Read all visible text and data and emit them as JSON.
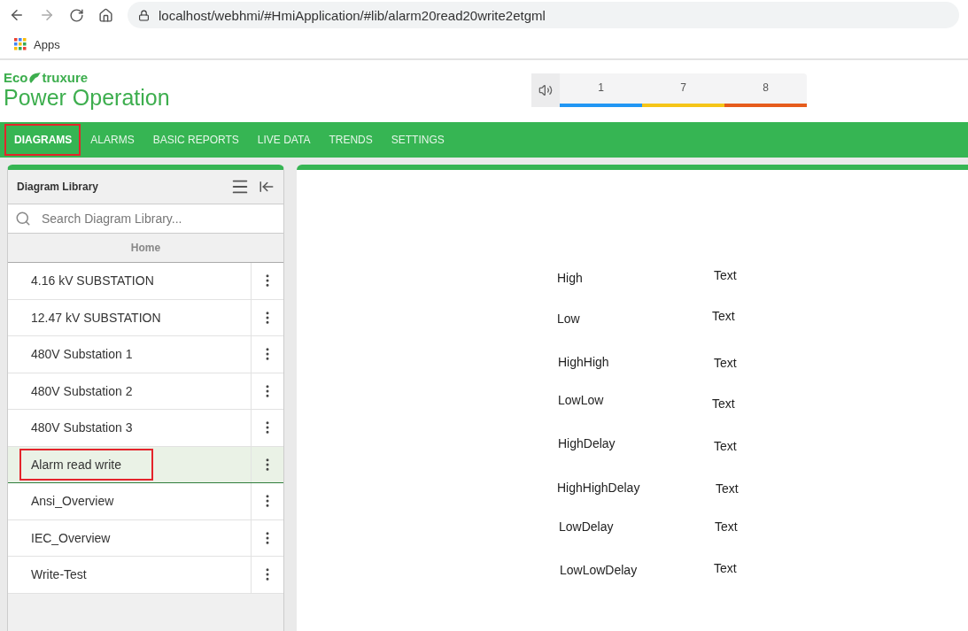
{
  "browser": {
    "url": "localhost/webhmi/#HmiApplication/#lib/alarm20read20write2etgml",
    "bookmarks": [
      "Apps"
    ]
  },
  "header": {
    "brand": "Eco",
    "brand_suffix": "truxure",
    "product": "Power Operation",
    "alarm_counts": [
      {
        "count": "1",
        "color": "#2196f3"
      },
      {
        "count": "7",
        "color": "#f5c518"
      },
      {
        "count": "8",
        "color": "#e65c1c"
      }
    ]
  },
  "nav": [
    {
      "label": "DIAGRAMS",
      "selected": true,
      "highlighted": true
    },
    {
      "label": "ALARMS",
      "selected": false,
      "highlighted": false
    },
    {
      "label": "BASIC REPORTS",
      "selected": false,
      "highlighted": false
    },
    {
      "label": "LIVE DATA",
      "selected": false,
      "highlighted": false
    },
    {
      "label": "TRENDS",
      "selected": false,
      "highlighted": false
    },
    {
      "label": "SETTINGS",
      "selected": false,
      "highlighted": false
    }
  ],
  "library": {
    "title": "Diagram Library",
    "search": {
      "placeholder": "Search Diagram Library..."
    },
    "breadcrumb": "Home",
    "items": [
      {
        "label": "4.16 kV SUBSTATION",
        "selected": false,
        "highlighted": false
      },
      {
        "label": "12.47 kV SUBSTATION",
        "selected": false,
        "highlighted": false
      },
      {
        "label": "480V Substation 1",
        "selected": false,
        "highlighted": false
      },
      {
        "label": "480V Substation 2",
        "selected": false,
        "highlighted": false
      },
      {
        "label": "480V Substation 3",
        "selected": false,
        "highlighted": false
      },
      {
        "label": "Alarm read write",
        "selected": true,
        "highlighted": true
      },
      {
        "label": "Ansi_Overview",
        "selected": false,
        "highlighted": false
      },
      {
        "label": "IEC_Overview",
        "selected": false,
        "highlighted": false
      },
      {
        "label": "Write-Test",
        "selected": false,
        "highlighted": false
      }
    ]
  },
  "diagram": {
    "rows": [
      {
        "label": "High",
        "value": "Text"
      },
      {
        "label": "Low",
        "value": "Text"
      },
      {
        "label": "HighHigh",
        "value": "Text"
      },
      {
        "label": "LowLow",
        "value": "Text"
      },
      {
        "label": "HighDelay",
        "value": "Text"
      },
      {
        "label": "HighHighDelay",
        "value": "Text"
      },
      {
        "label": "LowDelay",
        "value": "Text"
      },
      {
        "label": "LowLowDelay",
        "value": "Text"
      }
    ]
  }
}
